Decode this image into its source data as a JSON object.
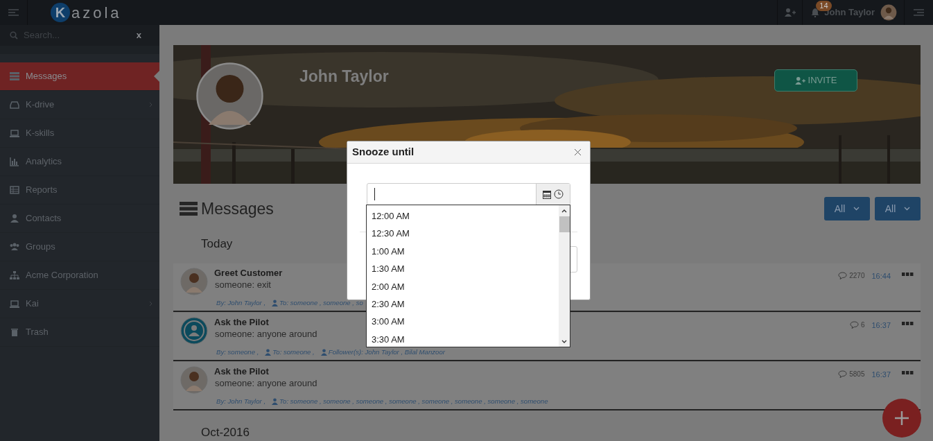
{
  "topbar": {
    "logo_letter": "K",
    "brand": "azola",
    "notification_count": "14",
    "user_name": "John Taylor"
  },
  "sidebar": {
    "search": {
      "placeholder": "Search...",
      "clear": "x"
    },
    "items": [
      {
        "label": "Messages",
        "kind": "messages",
        "selected": true,
        "has_children": false
      },
      {
        "label": "K-drive",
        "kind": "drive",
        "selected": false,
        "has_children": true
      },
      {
        "label": "K-skills",
        "kind": "laptop",
        "selected": false,
        "has_children": false
      },
      {
        "label": "Analytics",
        "kind": "chart",
        "selected": false,
        "has_children": false
      },
      {
        "label": "Reports",
        "kind": "table",
        "selected": false,
        "has_children": false
      },
      {
        "label": "Contacts",
        "kind": "user",
        "selected": false,
        "has_children": false
      },
      {
        "label": "Groups",
        "kind": "users",
        "selected": false,
        "has_children": false
      },
      {
        "label": "Acme Corporation",
        "kind": "sitemap",
        "selected": false,
        "has_children": false
      },
      {
        "label": "Kai",
        "kind": "laptop",
        "selected": false,
        "has_children": true
      },
      {
        "label": "Trash",
        "kind": "trash",
        "selected": false,
        "has_children": false
      }
    ]
  },
  "profile": {
    "name": "John Taylor",
    "invite": "INVITE"
  },
  "messages": {
    "heading": "Messages",
    "filters": [
      "All",
      "All"
    ],
    "groups": [
      {
        "label": "Today",
        "items": [
          {
            "title": "Greet Customer",
            "preview": "someone: exit",
            "by": "By:  John Taylor ,",
            "to": "To: someone , someone , so",
            "comments": "2270",
            "time": "16:44"
          },
          {
            "kind": "icon",
            "title": "Ask the Pilot",
            "preview": "someone: anyone around",
            "by": "By:  someone ,",
            "to": "To: someone ,",
            "followers": "Follower(s):  John Taylor , Bilal Manzoor",
            "comments": "6",
            "time": "16:37"
          },
          {
            "title": "Ask the Pilot",
            "preview": "someone: anyone around",
            "by": "By:  John Taylor ,",
            "to": "To: someone , someone , someone , someone , someone , someone , someone , someone",
            "comments": "5805",
            "time": "16:37"
          }
        ]
      },
      {
        "label": "Oct-2016"
      }
    ]
  },
  "modal": {
    "title": "Snooze until",
    "times": [
      "12:00 AM",
      "12:30 AM",
      "1:00 AM",
      "1:30 AM",
      "2:00 AM",
      "2:30 AM",
      "3:00 AM",
      "3:30 AM"
    ]
  }
}
